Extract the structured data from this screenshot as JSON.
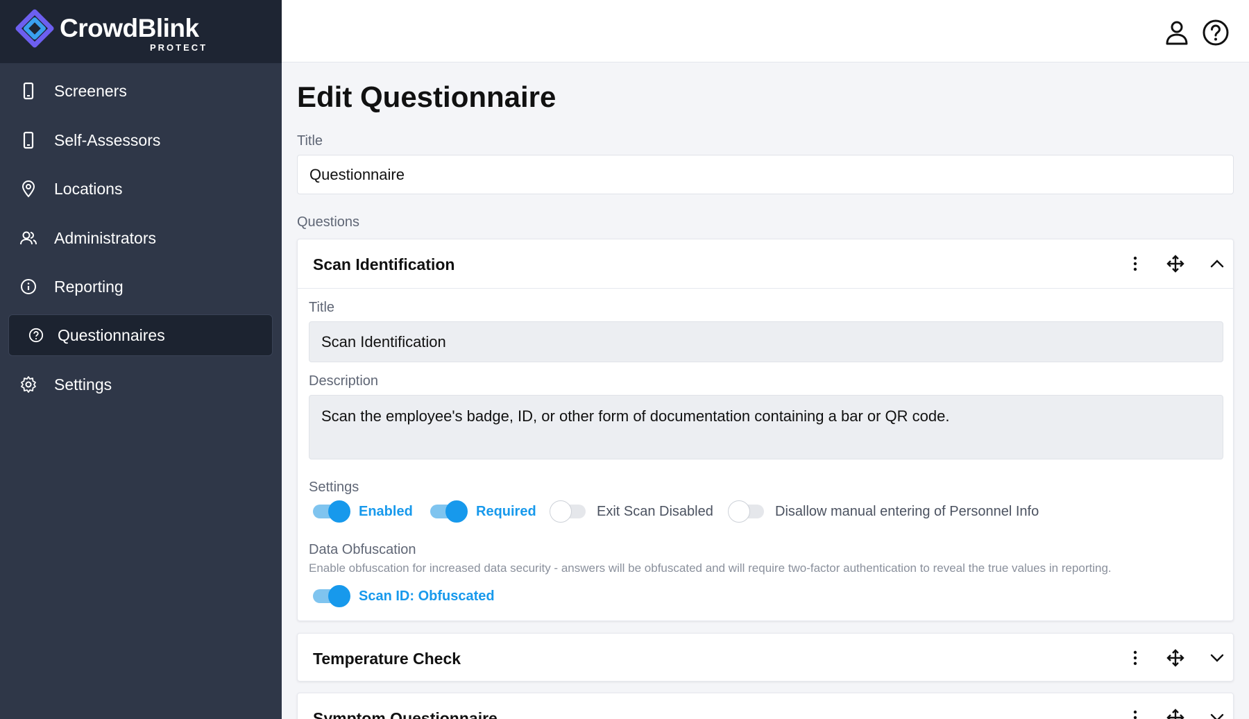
{
  "brand": {
    "name": "CrowdBlink",
    "sub": "PROTECT",
    "accent": "#6d5ff0"
  },
  "sidebar": {
    "items": [
      {
        "label": "Screeners",
        "icon": "phone-icon"
      },
      {
        "label": "Self-Assessors",
        "icon": "phone-icon"
      },
      {
        "label": "Locations",
        "icon": "map-pin-icon"
      },
      {
        "label": "Administrators",
        "icon": "users-icon"
      },
      {
        "label": "Reporting",
        "icon": "info-icon"
      },
      {
        "label": "Questionnaires",
        "icon": "question-circle-icon",
        "active": true
      },
      {
        "label": "Settings",
        "icon": "gear-icon"
      }
    ]
  },
  "topbar": {
    "icons": [
      "user-icon",
      "help-circle-icon"
    ]
  },
  "page": {
    "title": "Edit Questionnaire",
    "title_label": "Title",
    "title_value": "Questionnaire",
    "questions_label": "Questions"
  },
  "questions": [
    {
      "title": "Scan Identification",
      "expanded": true,
      "title_label": "Title",
      "title_value": "Scan Identification",
      "description_label": "Description",
      "description_value": "Scan the employee's badge, ID, or other form of documentation containing a bar or QR code.",
      "settings_label": "Settings",
      "settings": [
        {
          "label": "Enabled",
          "on": true
        },
        {
          "label": "Required",
          "on": true
        },
        {
          "label": "Exit Scan Disabled",
          "on": false
        },
        {
          "label": "Disallow manual entering of Personnel Info",
          "on": false
        }
      ],
      "obfuscation_label": "Data Obfuscation",
      "obfuscation_help": "Enable obfuscation for increased data security - answers will be obfuscated and will require two-factor authentication to reveal the true values in reporting.",
      "obfuscation_toggle": {
        "label": "Scan ID: Obfuscated",
        "on": true
      }
    },
    {
      "title": "Temperature Check",
      "expanded": false
    },
    {
      "title": "Symptom Questionnaire",
      "expanded": false
    }
  ],
  "colors": {
    "sidebar": "#2f3748",
    "brand_bar": "#1e2533",
    "toggle_on": "#1799ec"
  }
}
